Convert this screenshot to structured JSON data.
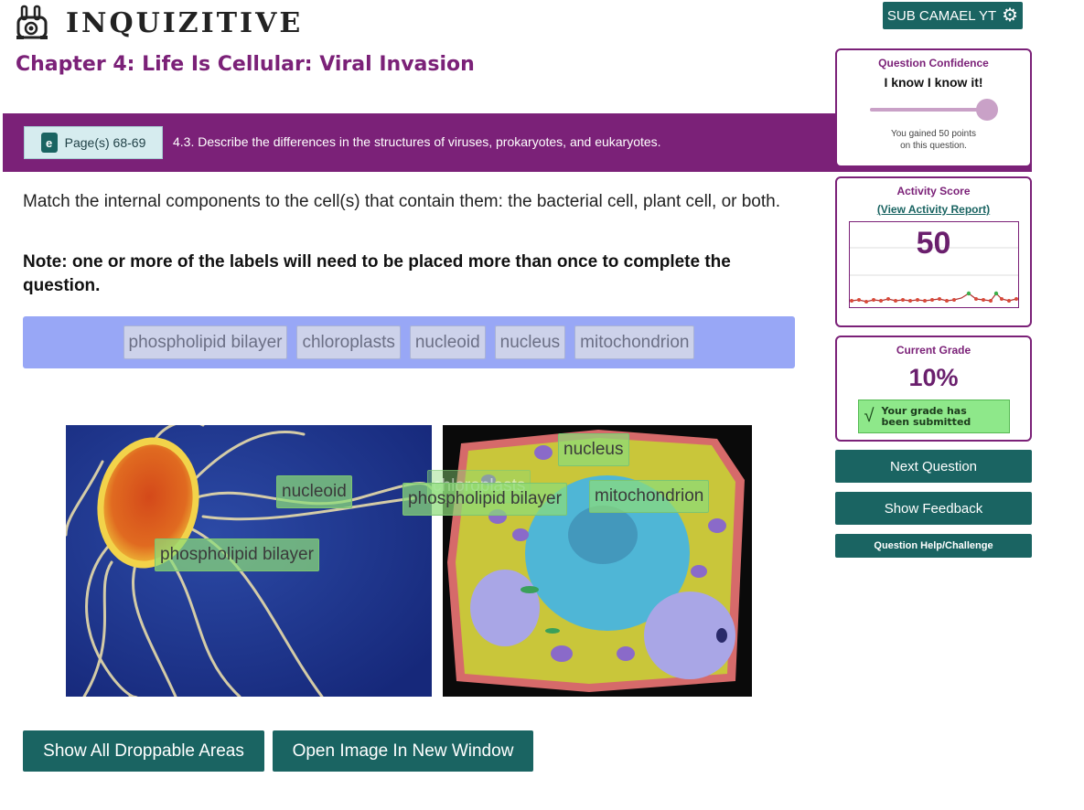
{
  "header": {
    "logo_text": "INQUIZITIVE",
    "user_button": "SUB CAMAEL YT",
    "chapter_title": "Chapter 4: Life Is Cellular: Viral Invasion"
  },
  "objective": {
    "pages_label": "Page(s) 68-69",
    "ebook_icon_letter": "e",
    "text": "4.3. Describe the differences in the structures of viruses, prokaryotes, and eukaryotes."
  },
  "question": {
    "prompt": "Match the internal components to the cell(s) that contain them: the bacterial cell, plant cell, or both.",
    "note": "Note: one or more of the labels will need to be placed more than once to complete the question."
  },
  "label_bank": [
    "phospholipid bilayer",
    "chloroplasts",
    "nucleoid",
    "nucleus",
    "mitochondrion"
  ],
  "placed_labels": {
    "bacterial_nucleoid": "nucleoid",
    "bacterial_bilayer": "phospholipid bilayer",
    "plant_nucleus": "nucleus",
    "plant_chloroplasts": "chloroplasts",
    "plant_bilayer": "phospholipid bilayer",
    "plant_mitochondrion": "mitochondrion"
  },
  "actions": {
    "show_droppable": "Show All Droppable Areas",
    "open_image": "Open Image In New Window"
  },
  "confidence": {
    "title": "Question Confidence",
    "value": "I know I know it!",
    "level": 1.0,
    "message_line1": "You gained 50 points",
    "message_line2": "on this question."
  },
  "activity": {
    "title": "Activity Score",
    "report_link": "(View Activity Report)",
    "score": "50"
  },
  "grade": {
    "title": "Current Grade",
    "value": "10%",
    "submitted_line1": "Your grade has",
    "submitted_line2": "been submitted"
  },
  "side_buttons": {
    "next": "Next Question",
    "feedback": "Show Feedback",
    "help": "Question Help/Challenge"
  },
  "colors": {
    "brand_purple": "#7b2178",
    "teal": "#1a6462",
    "bank_blue": "#98a7f6",
    "placed_green": "#8cdc78"
  }
}
